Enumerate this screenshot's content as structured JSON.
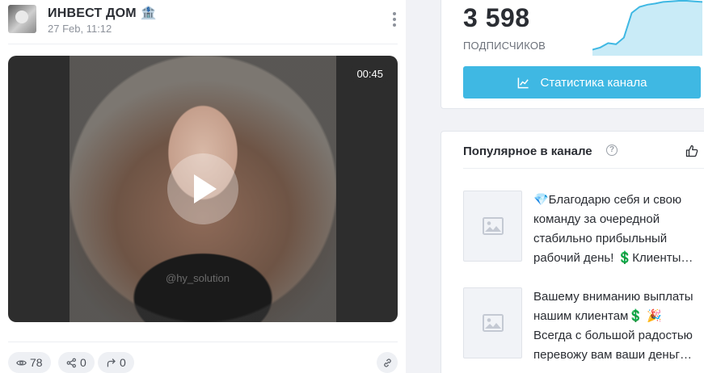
{
  "post": {
    "channel_name": "ИНВЕСТ ДОМ 🏦",
    "date": "27 Feb, 11:12",
    "video": {
      "duration": "00:45",
      "watermark": "@hy_solution"
    },
    "stats": {
      "views": "78",
      "shares": "0",
      "forwards": "0"
    }
  },
  "sidebar": {
    "subscribers": {
      "count": "3 598",
      "label": "ПОДПИСЧИКОВ",
      "trend": [
        0.08,
        0.12,
        0.2,
        0.18,
        0.3,
        0.75,
        0.86,
        0.9,
        0.92,
        0.95,
        0.96,
        0.97,
        0.97,
        0.96,
        0.95
      ]
    },
    "stats_button_label": "Статистика канала",
    "popular": {
      "title": "Популярное в канале",
      "help": "?",
      "items": [
        {
          "text": "💎Благодарю себя и свою команду за очередной стабильно прибыльный рабочий день! 💲Клиенты…"
        },
        {
          "text": "Вашему вниманию выплаты нашим клиентам💲 🎉 Всегда с большой радостью перевожу вам ваши деньг…"
        }
      ]
    }
  },
  "colors": {
    "accent": "#3fb8e3",
    "spark_line": "#3fb8e3",
    "spark_fill": "#c9ebf7"
  }
}
